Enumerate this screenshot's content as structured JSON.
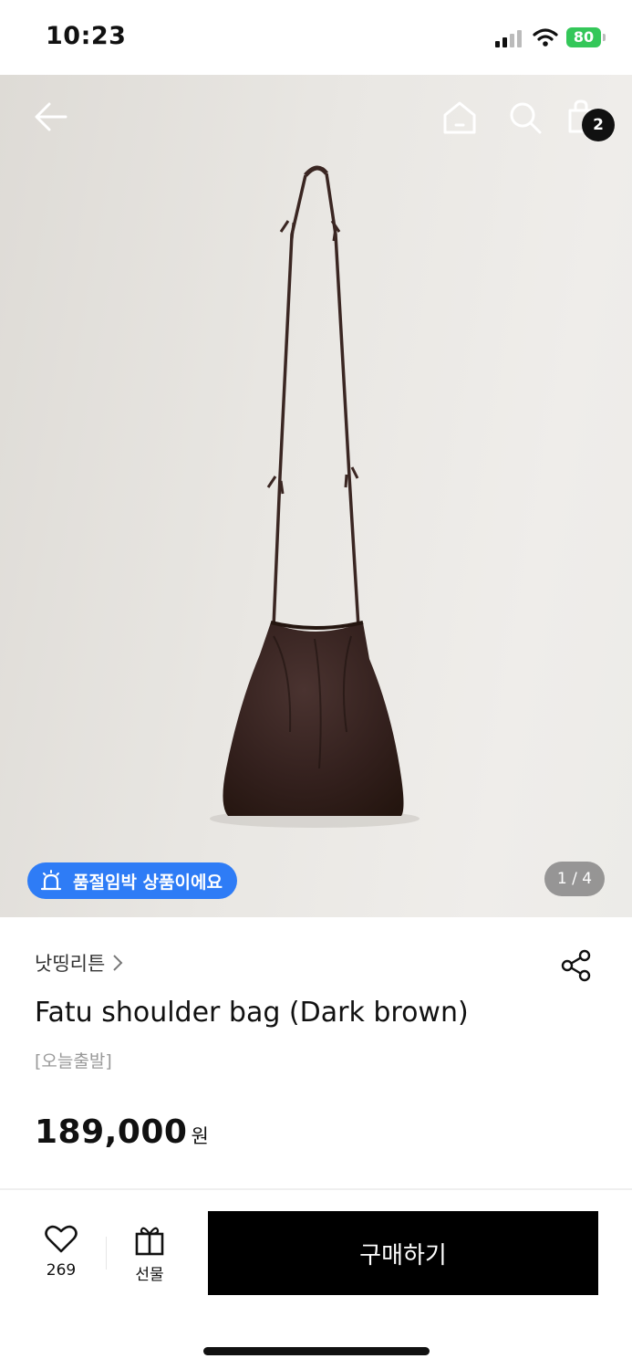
{
  "status_bar": {
    "time": "10:23",
    "battery": "80"
  },
  "header": {
    "cart_count": "2"
  },
  "gallery": {
    "stock_notice": "품절임박 상품이에요",
    "page_indicator": "1 / 4"
  },
  "product": {
    "brand": "낫띵리튼",
    "title": "Fatu shoulder bag (Dark brown)",
    "tag": "[오늘출발]",
    "price": "189,000",
    "currency": "원"
  },
  "bottom_bar": {
    "like_count": "269",
    "gift_label": "선물",
    "buy_label": "구매하기"
  },
  "colors": {
    "accent_blue": "#2e7cf6",
    "battery_green": "#34c759",
    "bag_brown": "#3a2622"
  }
}
